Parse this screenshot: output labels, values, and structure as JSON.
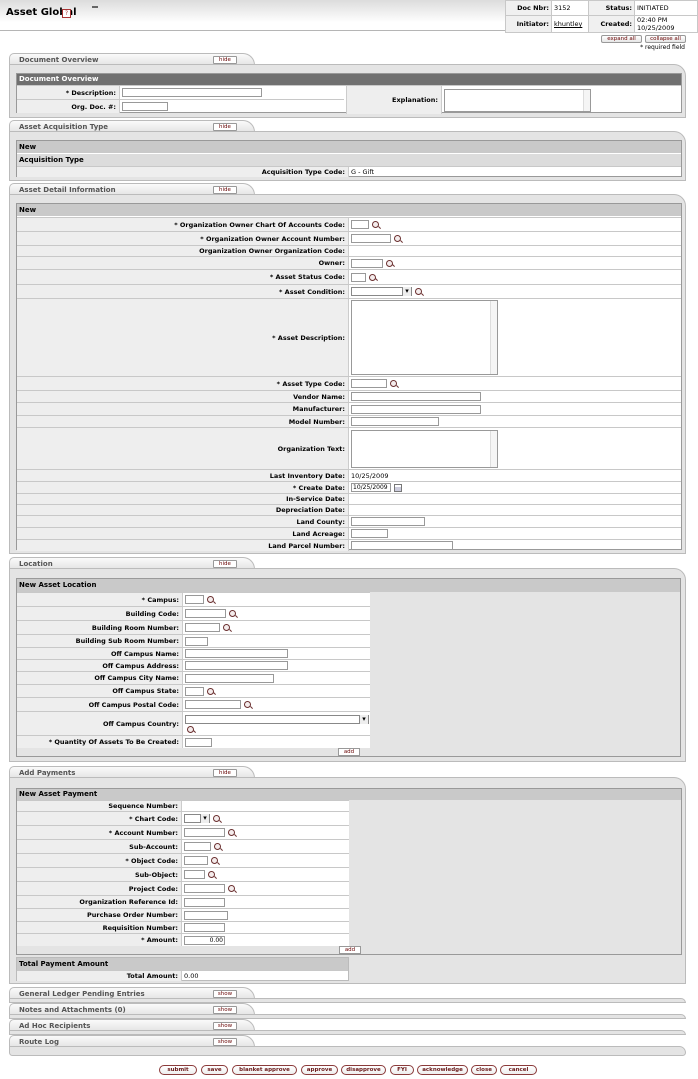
{
  "header": {
    "title": "Asset Global",
    "help_label": "?",
    "doc_nbr_label": "Doc Nbr:",
    "doc_nbr": "3152",
    "status_label": "Status:",
    "status": "INITIATED",
    "initiator_label": "Initiator:",
    "initiator": "khuntley",
    "created_label": "Created:",
    "created": "02:40 PM 10/25/2009"
  },
  "controls": {
    "expand_all": "expand all",
    "collapse_all": "collapse all",
    "required_note": "* required field"
  },
  "tabs": {
    "document_overview": {
      "title": "Document Overview",
      "toggle": "hide"
    },
    "acquisition": {
      "title": "Asset Acquisition Type",
      "toggle": "hide"
    },
    "detail": {
      "title": "Asset Detail Information",
      "toggle": "hide"
    },
    "location": {
      "title": "Location",
      "toggle": "hide"
    },
    "payments": {
      "title": "Add Payments",
      "toggle": "hide"
    },
    "glpe": {
      "title": "General Ledger Pending Entries",
      "toggle": "show"
    },
    "notes": {
      "title": "Notes and Attachments (0)",
      "toggle": "show"
    },
    "adhoc": {
      "title": "Ad Hoc Recipients",
      "toggle": "show"
    },
    "routelog": {
      "title": "Route Log",
      "toggle": "show"
    }
  },
  "overview": {
    "header": "Document Overview",
    "description_label": "* Description:",
    "org_doc_label": "Org. Doc. #:",
    "explanation_label": "Explanation:"
  },
  "acquisition": {
    "new_label": "New",
    "type_header": "Acquisition Type",
    "code_label": "Acquisition Type Code:",
    "code_value": "G - Gift"
  },
  "detail": {
    "new_label": "New",
    "chart_label": "*  Organization Owner Chart Of Accounts Code:",
    "account_label": "*  Organization Owner Account Number:",
    "org_code_label": "Organization Owner Organization Code:",
    "owner_label": "Owner:",
    "status_code_label": "*  Asset Status Code:",
    "condition_label": "*  Asset Condition:",
    "description_label": "*  Asset Description:",
    "type_code_label": "*  Asset Type Code:",
    "vendor_label": "Vendor Name:",
    "manufacturer_label": "Manufacturer:",
    "model_label": "Model Number:",
    "org_text_label": "Organization Text:",
    "last_inventory_label": "Last Inventory Date:",
    "last_inventory_value": "10/25/2009",
    "create_date_label": "*  Create Date:",
    "create_date_value": "10/25/2009",
    "in_service_label": "In-Service Date:",
    "depreciation_label": "Depreciation Date:",
    "land_county_label": "Land County:",
    "land_acreage_label": "Land Acreage:",
    "land_parcel_label": "Land Parcel Number:"
  },
  "location": {
    "header": "New Asset Location",
    "campus_label": "*  Campus:",
    "building_code_label": "Building Code:",
    "room_label": "Building Room Number:",
    "sub_room_label": "Building Sub Room Number:",
    "off_name_label": "Off Campus Name:",
    "off_address_label": "Off Campus Address:",
    "off_city_label": "Off Campus City Name:",
    "off_state_label": "Off Campus State:",
    "off_postal_label": "Off Campus Postal Code:",
    "off_country_label": "Off Campus Country:",
    "quantity_label": "*  Quantity Of Assets To Be Created:",
    "add_label": "add"
  },
  "payment": {
    "header": "New Asset Payment",
    "sequence_label": "Sequence Number:",
    "chart_label": "*  Chart Code:",
    "account_label": "*  Account Number:",
    "sub_account_label": "Sub-Account:",
    "object_label": "*  Object Code:",
    "sub_object_label": "Sub-Object:",
    "project_label": "Project Code:",
    "org_ref_label": "Organization Reference Id:",
    "po_label": "Purchase Order Number:",
    "req_label": "Requisition Number:",
    "amount_label": "*  Amount:",
    "amount_value": "0.00",
    "add_label": "add",
    "total_header": "Total Payment Amount",
    "total_label": "Total Amount:",
    "total_value": "0.00"
  },
  "buttons": {
    "submit": "submit",
    "save": "save",
    "blanket_approve": "blanket approve",
    "approve": "approve",
    "disapprove": "disapprove",
    "fyi": "FYI",
    "acknowledge": "acknowledge",
    "close": "close",
    "cancel": "cancel"
  }
}
